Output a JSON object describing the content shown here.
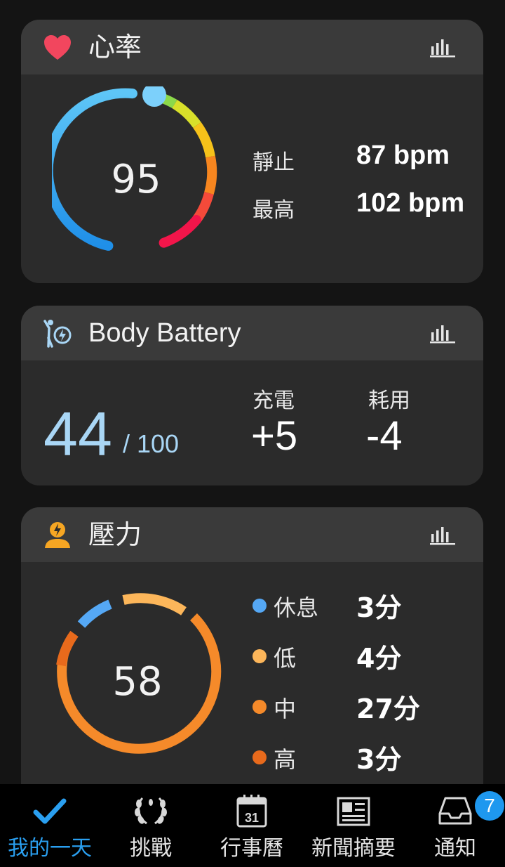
{
  "heart_rate": {
    "title": "心率",
    "current": "95",
    "resting_label": "靜止",
    "resting_value": "87 bpm",
    "max_label": "最高",
    "max_value": "102 bpm",
    "icon": "heart-icon"
  },
  "body_battery": {
    "title": "Body Battery",
    "value": "44",
    "max": "/ 100",
    "charged_label": "充電",
    "charged_value": "+5",
    "drained_label": "耗用",
    "drained_value": "-4",
    "icon": "body-battery-icon"
  },
  "stress": {
    "title": "壓力",
    "value": "58",
    "icon": "stress-icon",
    "levels": [
      {
        "label": "休息",
        "value": "3分",
        "color": "#55a8f5"
      },
      {
        "label": "低",
        "value": "4分",
        "color": "#fcb65a"
      },
      {
        "label": "中",
        "value": "27分",
        "color": "#f58a2a"
      },
      {
        "label": "高",
        "value": "3分",
        "color": "#e86a1c"
      }
    ]
  },
  "bottom_nav": {
    "items": [
      {
        "label": "我的一天",
        "icon": "checkmark-icon",
        "active": true
      },
      {
        "label": "挑戰",
        "icon": "laurel-icon"
      },
      {
        "label": "行事曆",
        "icon": "calendar-icon",
        "day": "31"
      },
      {
        "label": "新聞摘要",
        "icon": "newspaper-icon"
      },
      {
        "label": "通知",
        "icon": "inbox-icon",
        "badge": "7"
      }
    ]
  },
  "colors": {
    "accent": "#2a9ff0",
    "card": "#2b2b2b",
    "card_header": "#3a3a3a",
    "heart": "#f2465e",
    "battery": "#a9d6f5"
  }
}
